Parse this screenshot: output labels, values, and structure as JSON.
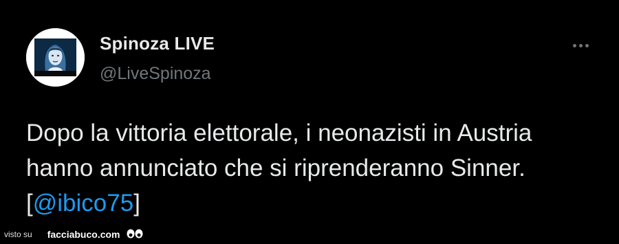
{
  "tweet": {
    "author": {
      "display_name": "Spinoza LIVE",
      "handle": "@LiveSpinoza"
    },
    "text_lines": [
      "Dopo la vittoria elettorale, i neonazisti in Austria",
      "hanno annunciato che si riprenderanno Sinner."
    ],
    "credit": {
      "open": "[",
      "mention": "@ibico75",
      "close": "]"
    }
  },
  "watermark": {
    "prefix": "visto su",
    "site": "facciabuco.com"
  },
  "colors": {
    "background": "#000000",
    "text_primary": "#e7e9ea",
    "text_secondary": "#71767b",
    "link": "#1d9bf0"
  },
  "icons": {
    "more": "more-horizontal-icon",
    "watermark": "eyes-icon"
  }
}
